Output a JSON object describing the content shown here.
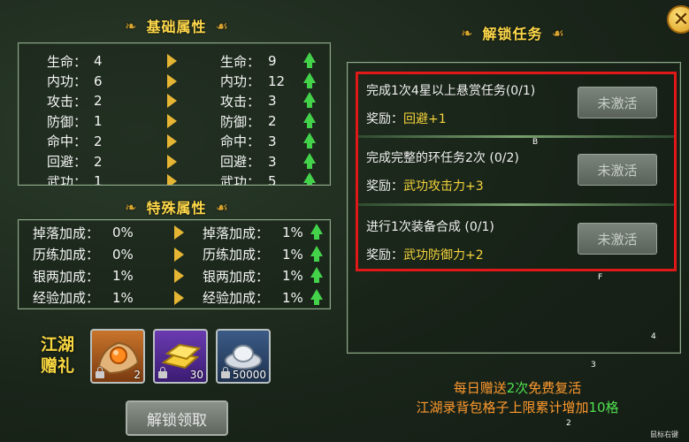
{
  "basic": {
    "title": "基础属性",
    "rows": [
      {
        "label": "生命：",
        "cur": "4",
        "nlabel": "生命：",
        "next": "9"
      },
      {
        "label": "内功：",
        "cur": "6",
        "nlabel": "内功：",
        "next": "12"
      },
      {
        "label": "攻击：",
        "cur": "2",
        "nlabel": "攻击：",
        "next": "3"
      },
      {
        "label": "防御：",
        "cur": "1",
        "nlabel": "防御：",
        "next": "2"
      },
      {
        "label": "命中：",
        "cur": "2",
        "nlabel": "命中：",
        "next": "3"
      },
      {
        "label": "回避：",
        "cur": "2",
        "nlabel": "回避：",
        "next": "3"
      },
      {
        "label": "武功：",
        "cur": "1",
        "nlabel": "武功：",
        "next": "5"
      }
    ]
  },
  "special": {
    "title": "特殊属性",
    "rows": [
      {
        "label": "掉落加成：",
        "cur": "0%",
        "nlabel": "掉落加成：",
        "next": "1%"
      },
      {
        "label": "历练加成：",
        "cur": "0%",
        "nlabel": "历练加成：",
        "next": "1%"
      },
      {
        "label": "银两加成：",
        "cur": "1%",
        "nlabel": "银两加成：",
        "next": "1%"
      },
      {
        "label": "经验加成：",
        "cur": "1%",
        "nlabel": "经验加成：",
        "next": "1%"
      }
    ]
  },
  "gift": {
    "label_line1": "江湖",
    "label_line2": "赠礼",
    "items": [
      {
        "icon": "orb-bundle-icon",
        "count": "2"
      },
      {
        "icon": "gold-bars-icon",
        "count": "30"
      },
      {
        "icon": "silver-ingot-icon",
        "count": "50000"
      }
    ],
    "unlock_button": "解锁领取"
  },
  "tasks": {
    "title": "解锁任务",
    "items": [
      {
        "title": "完成1次4星以上悬赏任务(0/1)",
        "reward_label": "奖励：",
        "reward_value": "回避+1",
        "status": "未激活"
      },
      {
        "title": "完成完整的环任务2次 (0/2)",
        "reward_label": "奖励：",
        "reward_value": "武功攻击力+3",
        "status": "未激活"
      },
      {
        "title": "进行1次装备合成 (0/1)",
        "reward_label": "奖励：",
        "reward_value": "武功防御力+2",
        "status": "未激活"
      }
    ],
    "notes": {
      "line1_a": "每日赠送",
      "line1_b": "2次",
      "line1_c": "免费复活",
      "line2_a": "江湖录背包格子上限累计增加",
      "line2_b": "10格"
    }
  },
  "markers": {
    "b": "B",
    "f": "F",
    "m4": "4",
    "m3": "3",
    "m2": "2",
    "corner": "鼠标右键"
  },
  "colors": {
    "gold": "#ffd94a",
    "red_frame": "#e01818",
    "green_up": "#43d24a",
    "note_orange": "#ff9a2e",
    "note_green": "#4fe04f"
  }
}
